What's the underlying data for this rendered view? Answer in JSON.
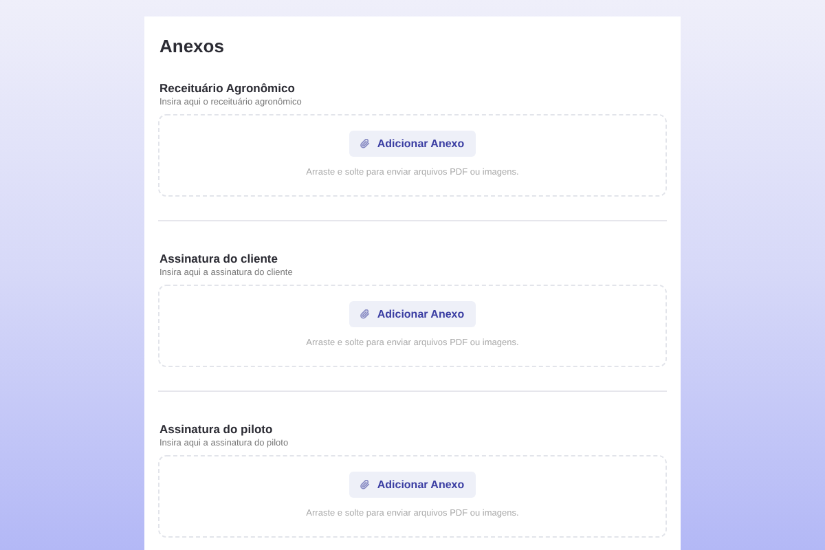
{
  "title": "Anexos",
  "sections": [
    {
      "label": "Receituário Agronômico",
      "hint": "Insira aqui o receituário agronômico",
      "button": "Adicionar Anexo",
      "dropzone_text": "Arraste e solte para enviar arquivos PDF ou imagens."
    },
    {
      "label": "Assinatura do cliente",
      "hint": "Insira aqui a assinatura do cliente",
      "button": "Adicionar Anexo",
      "dropzone_text": "Arraste e solte para enviar arquivos PDF ou imagens."
    },
    {
      "label": "Assinatura do piloto",
      "hint": "Insira aqui a assinatura do piloto",
      "button": "Adicionar Anexo",
      "dropzone_text": "Arraste e solte para enviar arquivos PDF ou imagens."
    }
  ]
}
